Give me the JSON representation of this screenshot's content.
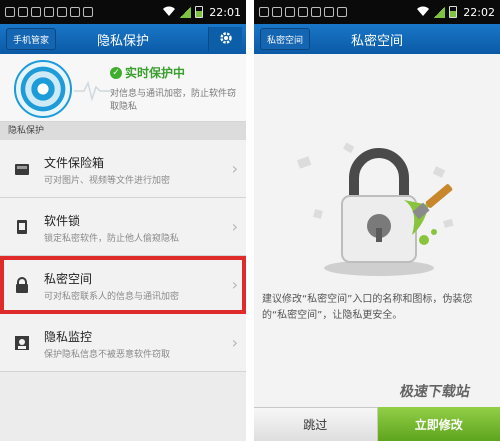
{
  "left": {
    "status_time": "22:01",
    "back_label": "手机管家",
    "title": "隐私保护",
    "hero": {
      "status": "实时保护中",
      "desc": "对信息与通讯加密，防止软件窃取隐私"
    },
    "section_label": "隐私保护",
    "items": [
      {
        "title": "文件保险箱",
        "sub": "可对图片、视频等文件进行加密"
      },
      {
        "title": "软件锁",
        "sub": "锁定私密软件，防止他人偷窥隐私"
      },
      {
        "title": "私密空间",
        "sub": "可对私密联系人的信息与通讯加密"
      },
      {
        "title": "隐私监控",
        "sub": "保护隐私信息不被恶意软件窃取"
      }
    ]
  },
  "right": {
    "status_time": "22:02",
    "back_label": "私密空间",
    "title": "私密空间",
    "hint": "建议修改“私密空间”入口的名称和图标，伪装您的“私密空间”，让隐私更安全。",
    "skip_label": "跳过",
    "now_label": "立即修改"
  },
  "watermark": "极速下载站",
  "colors": {
    "appbar": "#0b5aa6",
    "accent_green": "#5ea41d",
    "highlight": "#e02b2b"
  }
}
